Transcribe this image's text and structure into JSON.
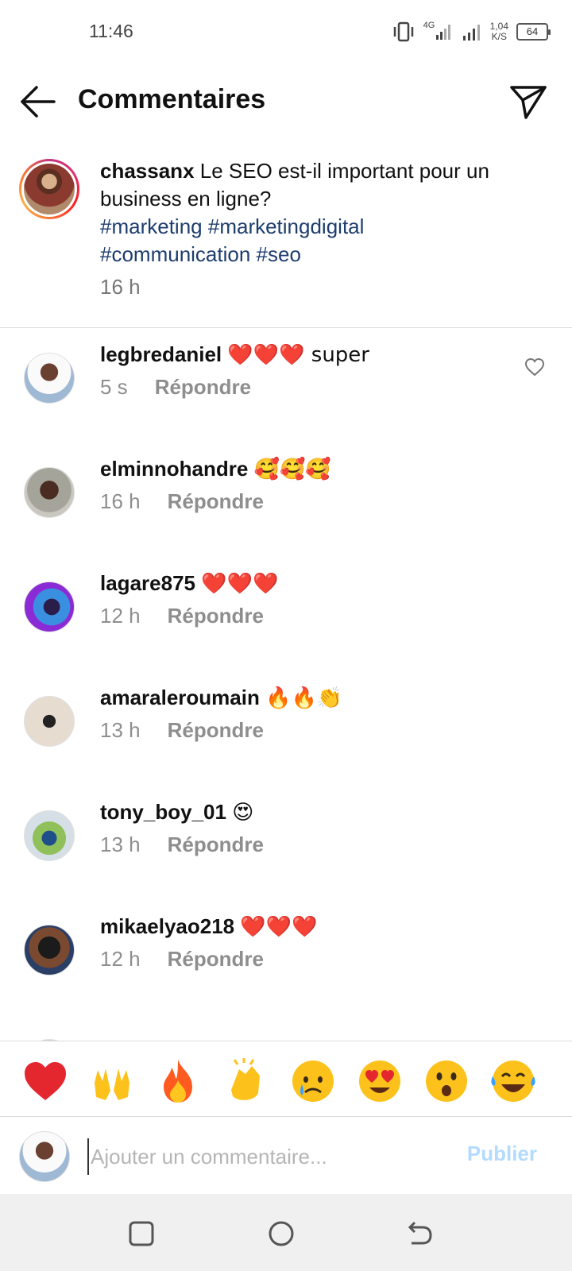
{
  "status_bar": {
    "time": "11:46",
    "network": "4G",
    "speed_value": "1,04",
    "speed_unit": "K/S",
    "battery": "64"
  },
  "header": {
    "title": "Commentaires"
  },
  "caption": {
    "username": "chassanx",
    "text": "Le SEO est-il important pour un business en ligne?",
    "hashtags": [
      "#marketing",
      "#marketingdigital",
      "#communication",
      "#seo"
    ],
    "time": "16 h"
  },
  "comments": [
    {
      "username": "legbredaniel",
      "text": "❤️❤️❤️ super",
      "time": "5 s",
      "reply": "Répondre"
    },
    {
      "username": "elminnohandre",
      "text": "🥰🥰🥰",
      "time": "16 h",
      "reply": "Répondre"
    },
    {
      "username": "lagare875",
      "text": "❤️❤️❤️",
      "time": "12 h",
      "reply": "Répondre"
    },
    {
      "username": "amaraleroumain",
      "text": "🔥🔥👏",
      "time": "13 h",
      "reply": "Répondre"
    },
    {
      "username": "tony_boy_01",
      "text": "😍",
      "time": "13 h",
      "reply": "Répondre"
    },
    {
      "username": "mikaelyao218",
      "text": "❤️❤️❤️",
      "time": "12 h",
      "reply": "Répondre"
    }
  ],
  "quick_emojis": [
    "❤️",
    "🙌",
    "🔥",
    "👏",
    "😢",
    "😍",
    "😮",
    "😂"
  ],
  "comment_input": {
    "placeholder": "Ajouter un commentaire...",
    "publish_label": "Publier"
  },
  "colors": {
    "hashtag": "#1d3d6e",
    "publish_disabled": "#b3dbff",
    "secondary_text": "#8e8e8e"
  }
}
